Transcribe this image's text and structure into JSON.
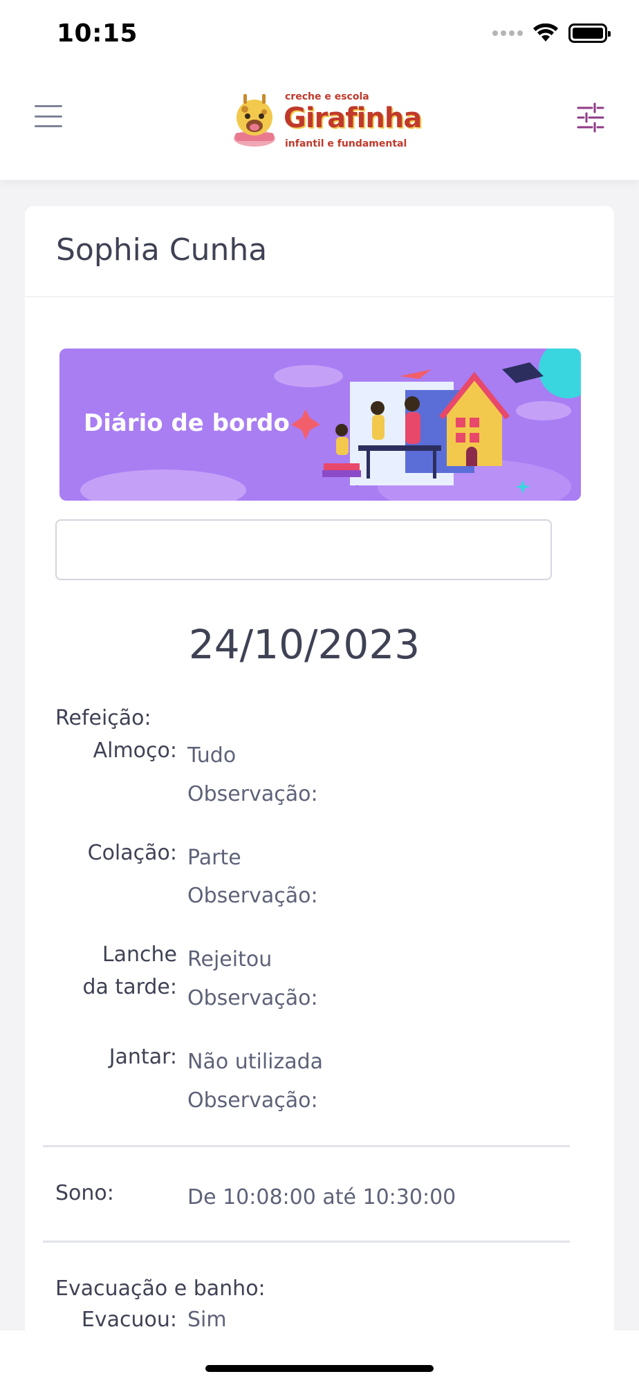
{
  "status_bar": {
    "time": "10:15"
  },
  "header": {
    "logo": {
      "top_text": "creche e escola",
      "main_text": "Girafinha",
      "sub_text": "infantil e fundamental"
    }
  },
  "card": {
    "student_name": "Sophia Cunha",
    "banner_title": "Diário de bordo",
    "date_input_value": "",
    "date": "24/10/2023",
    "meals": {
      "section_label": "Refeição:",
      "items": [
        {
          "label_line1": "Almoço:",
          "label_line2": "",
          "value": "Tudo",
          "obs_label": "Observação:"
        },
        {
          "label_line1": "Colação:",
          "label_line2": "",
          "value": "Parte",
          "obs_label": "Observação:"
        },
        {
          "label_line1": "Lanche",
          "label_line2": "da tarde:",
          "value": "Rejeitou",
          "obs_label": "Observação:"
        },
        {
          "label_line1": "Jantar:",
          "label_line2": "",
          "value": "Não utilizada",
          "obs_label": "Observação:"
        }
      ]
    },
    "sleep": {
      "label": "Sono:",
      "value": "De 10:08:00 até 10:30:00"
    },
    "hygiene": {
      "section_label": "Evacuação e banho:",
      "evacuated_label": "Evacuou:",
      "evacuated_value": "Sim"
    }
  },
  "colors": {
    "accent": "#a97ef3",
    "text": "#3f4254",
    "muted": "#5e6278",
    "brand": "#c0392b",
    "filter_icon": "#8e3a86"
  }
}
